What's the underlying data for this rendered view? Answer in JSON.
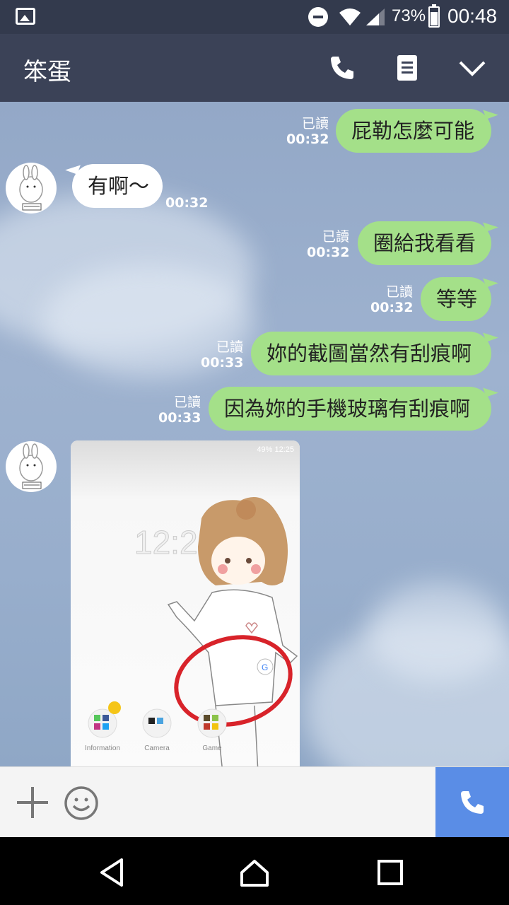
{
  "status_bar": {
    "battery_percent": "73%",
    "battery_level": 0.73,
    "time": "00:48",
    "icons": [
      "gallery-icon",
      "do-not-disturb-icon",
      "wifi-icon",
      "signal-icon",
      "battery-icon"
    ]
  },
  "header": {
    "title": "笨蛋",
    "actions": [
      "phone-icon",
      "notes-icon",
      "chevron-down-icon"
    ]
  },
  "messages": [
    {
      "direction": "out",
      "text": "屁勒怎麼可能",
      "read": "已讀",
      "time": "00:32"
    },
    {
      "direction": "in",
      "text": "有啊～",
      "time": "00:32"
    },
    {
      "direction": "out",
      "text": "圈給我看看",
      "read": "已讀",
      "time": "00:32"
    },
    {
      "direction": "out",
      "text": "等等",
      "read": "已讀",
      "time": "00:32"
    },
    {
      "direction": "out",
      "text": "妳的截圖當然有刮痕啊",
      "read": "已讀",
      "time": "00:33"
    },
    {
      "direction": "out",
      "text": "因為妳的手機玻璃有刮痕啊",
      "read": "已讀",
      "time": "00:33"
    },
    {
      "direction": "in",
      "type": "image"
    }
  ],
  "photo": {
    "status_text": "49% 12:25",
    "clock": "12:25",
    "app_labels": [
      "Information",
      "Camera",
      "Game"
    ]
  },
  "colors": {
    "header_bg": "#3b4257",
    "status_bg": "#333a4d",
    "outgoing_bubble": "#a4e089",
    "incoming_bubble": "#ffffff",
    "call_button": "#5a8de6"
  },
  "input_bar": {
    "icons": [
      "plus-icon",
      "emoji-icon",
      "call-icon"
    ]
  },
  "nav_bar": {
    "icons": [
      "back-icon",
      "home-icon",
      "recents-icon"
    ]
  }
}
